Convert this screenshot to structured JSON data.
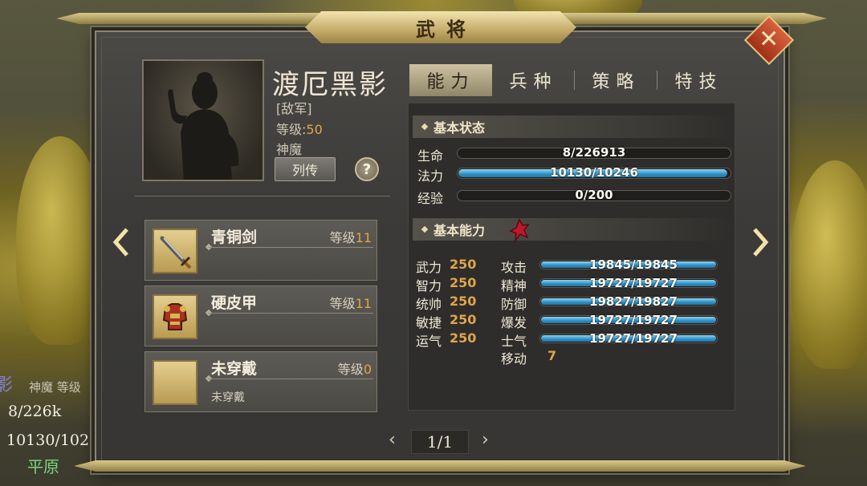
{
  "window_title": "武将",
  "close_icon": "close-x-icon",
  "hero": {
    "name": "渡厄黑影",
    "side": "[敌军]",
    "level_label": "等级:",
    "level_value": "50",
    "race": "神魔",
    "bio_button": "列传",
    "help_button": "?"
  },
  "tabs": [
    {
      "label": "能力",
      "active": true
    },
    {
      "label": "兵种",
      "active": false
    },
    {
      "label": "策略",
      "active": false
    },
    {
      "label": "特技",
      "active": false
    }
  ],
  "equipment": [
    {
      "name": "青铜剑",
      "level_label": "等级",
      "level": "11",
      "subtitle": "",
      "icon": "bronze-sword-icon"
    },
    {
      "name": "硬皮甲",
      "level_label": "等级",
      "level": "11",
      "subtitle": "",
      "icon": "leather-armor-icon"
    },
    {
      "name": "未穿戴",
      "level_label": "等级",
      "level": "0",
      "subtitle": "未穿戴",
      "icon": "empty-slot"
    }
  ],
  "basic_status": {
    "header": "基本状态",
    "bars": [
      {
        "label": "生命",
        "text": "8/226913",
        "fill": 0.0
      },
      {
        "label": "法力",
        "text": "10130/10246",
        "fill": 0.99
      },
      {
        "label": "经验",
        "text": "0/200",
        "fill": 0.0
      }
    ]
  },
  "basic_ability": {
    "header": "基本能力",
    "icon": "rage-flame-icon",
    "attributes": [
      {
        "name": "武力",
        "value": "250"
      },
      {
        "name": "智力",
        "value": "250"
      },
      {
        "name": "统帅",
        "value": "250"
      },
      {
        "name": "敏捷",
        "value": "250"
      },
      {
        "name": "运气",
        "value": "250"
      }
    ],
    "combat_stats": [
      {
        "name": "攻击",
        "text": "19845/19845",
        "fill": 1.0
      },
      {
        "name": "精神",
        "text": "19727/19727",
        "fill": 1.0
      },
      {
        "name": "防御",
        "text": "19827/19827",
        "fill": 1.0
      },
      {
        "name": "爆发",
        "text": "19727/19727",
        "fill": 1.0
      },
      {
        "name": "士气",
        "text": "19727/19727",
        "fill": 1.0
      }
    ],
    "move_label": "移动",
    "move_value": "7"
  },
  "pager": {
    "text": "1/1",
    "prev": "‹",
    "next": "›"
  },
  "behind_panel": {
    "name": "影",
    "tag": "神魔 等级",
    "hp": "8/226k",
    "mp": "10130/102",
    "terrain": "平原"
  },
  "colors": {
    "accent_gold": "#e0a54a",
    "bar_blue": "#2f8fc4",
    "close_red": "#c04a2a"
  }
}
